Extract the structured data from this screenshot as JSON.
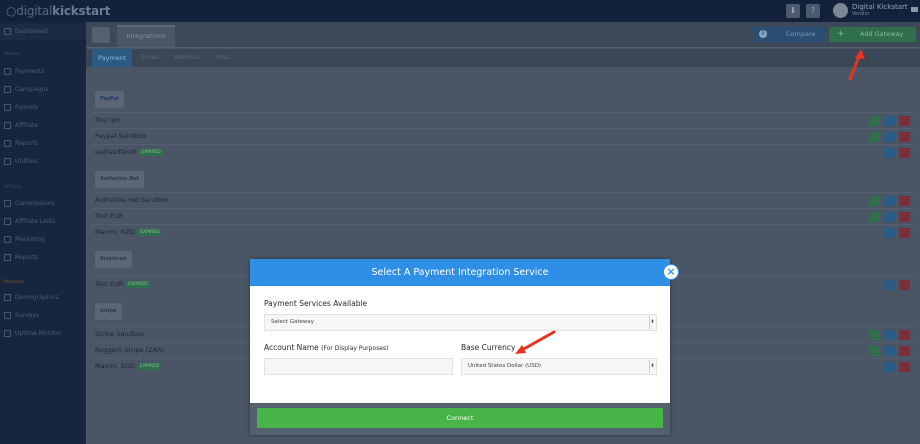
{
  "app": {
    "logo_light": "○digital",
    "logo_bold": "kickstart"
  },
  "topbar": {
    "user_name": "Digital Kickstart",
    "user_role": "Vendor"
  },
  "sidebar": {
    "items_top": [
      {
        "label": "Dashboard"
      }
    ],
    "head_vendor": "Vendor",
    "items_vendor": [
      {
        "label": "Payments"
      },
      {
        "label": "Campaigns"
      },
      {
        "label": "Funnels"
      },
      {
        "label": "Affiliate"
      },
      {
        "label": "Reports"
      },
      {
        "label": "Utilities"
      }
    ],
    "head_affiliate": "Affiliate",
    "items_affiliate": [
      {
        "label": "Commissions"
      },
      {
        "label": "Affiliate Links"
      },
      {
        "label": "Marketing"
      },
      {
        "label": "Reports"
      }
    ],
    "head_premium": "Premium",
    "items_premium": [
      {
        "label": "Demographics"
      },
      {
        "label": "Surveys"
      },
      {
        "label": "Uptime Monitor"
      }
    ]
  },
  "main": {
    "tab": "Integrations",
    "compare_label": "Compare",
    "add_gateway_label": "Add Gateway",
    "subtabs": [
      "Payment",
      "Email",
      "Webinar",
      "Misc"
    ],
    "gateways": [
      {
        "brand": "PayPal",
        "rows": [
          {
            "name": "Test ipn",
            "badge": ""
          },
          {
            "name": "Paypal Sandbox",
            "badge": ""
          },
          {
            "name": "asdfasdfasdf",
            "badge": "EXPIRED"
          }
        ]
      },
      {
        "brand": "Authorize.Net",
        "rows": [
          {
            "name": "Authorize.net Sandbox",
            "badge": ""
          },
          {
            "name": "Test EUR",
            "badge": ""
          },
          {
            "name": "Maxim. NZD",
            "badge": "EXPIRED"
          }
        ]
      },
      {
        "brand": "Braintree",
        "rows": [
          {
            "name": "Test EUR",
            "badge": "EXPIRED"
          }
        ]
      },
      {
        "brand": "stripe",
        "rows": [
          {
            "name": "Stripe Sandbox",
            "badge": ""
          },
          {
            "name": "Ruggero Stripe (ZAR)",
            "badge": ""
          },
          {
            "name": "Maxim. SGD",
            "badge": "EXPIRED"
          }
        ]
      }
    ]
  },
  "modal": {
    "title": "Select A Payment Integration Service",
    "services_label": "Payment Services Available",
    "services_value": "Select Gateway",
    "account_label": "Account Name",
    "account_hint": "(For Display Purposes)",
    "account_value": "",
    "currency_label": "Base Currency",
    "currency_value": "United States Dollar (USD)",
    "connect_label": "Connect"
  },
  "colors": {
    "accent": "#2f8fe6",
    "success": "#47b44a",
    "danger": "#7a2f3a"
  }
}
